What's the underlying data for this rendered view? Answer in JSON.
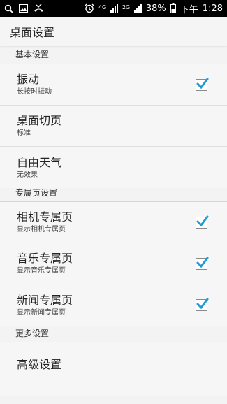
{
  "status_bar": {
    "net1": "4G",
    "net2": "2G",
    "battery": "38%",
    "ampm": "下午",
    "time": "1:28"
  },
  "app_bar": {
    "title": "桌面设置"
  },
  "sections": {
    "basic": "基本设置",
    "exclusive": "专属页设置",
    "more": "更多设置"
  },
  "prefs": {
    "vibrate": {
      "title": "振动",
      "summary": "长按时振动",
      "checked": true
    },
    "page_switch": {
      "title": "桌面切页",
      "summary": "标准"
    },
    "weather": {
      "title": "自由天气",
      "summary": "无效果"
    },
    "camera_page": {
      "title": "相机专属页",
      "summary": "显示相机专属页",
      "checked": true
    },
    "music_page": {
      "title": "音乐专属页",
      "summary": "显示音乐专属页",
      "checked": true
    },
    "news_page": {
      "title": "新闻专属页",
      "summary": "显示新闻专属页",
      "checked": true
    },
    "advanced": {
      "title": "高级设置"
    }
  },
  "colors": {
    "check_accent": "#1e9bd6",
    "status_bg": "#000000"
  },
  "icons": [
    "search-icon",
    "image-icon",
    "missed-call-icon",
    "alarm-icon",
    "signal-icon",
    "battery-icon"
  ]
}
